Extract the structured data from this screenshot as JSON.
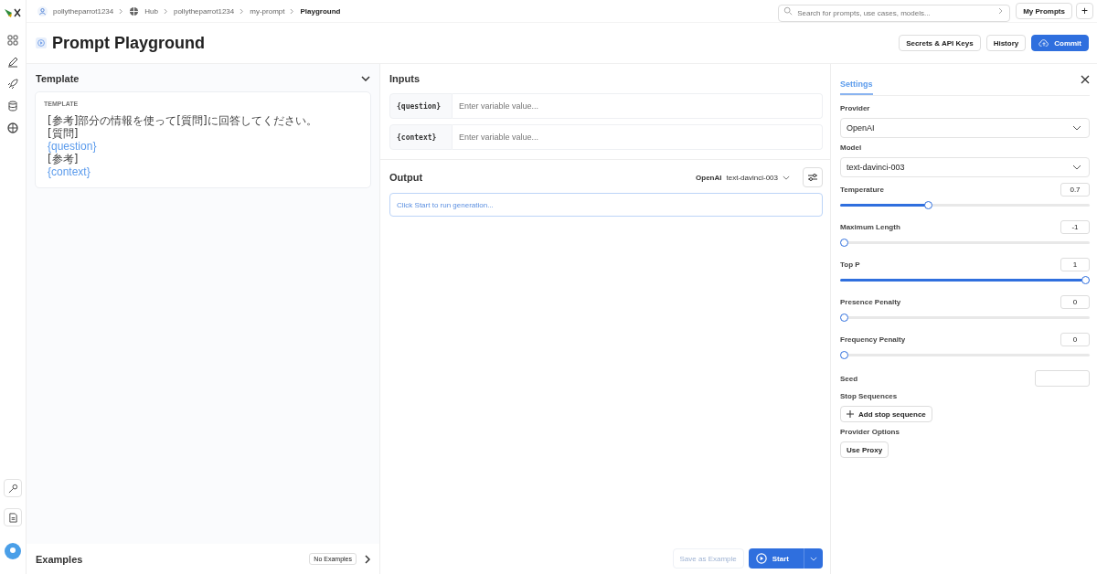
{
  "breadcrumbs": [
    {
      "label": "pollytheparrot1234",
      "kind": "user",
      "current": false
    },
    {
      "label": "Hub",
      "kind": "hub",
      "current": false
    },
    {
      "label": "pollytheparrot1234",
      "kind": "plain",
      "current": false
    },
    {
      "label": "my-prompt",
      "kind": "plain",
      "current": false
    },
    {
      "label": "Playground",
      "kind": "plain",
      "current": true
    }
  ],
  "search": {
    "placeholder": "Search for prompts, use cases, models..."
  },
  "top_buttons": {
    "my_prompts": "My Prompts",
    "add": "+"
  },
  "page_title": "Prompt Playground",
  "header_buttons": {
    "secrets": "Secrets & API Keys",
    "history": "History",
    "commit": "Commit"
  },
  "template": {
    "title": "Template",
    "label": "TEMPLATE",
    "lines": [
      {
        "text": "[参考]部分の情報を使って[質問]に回答してください。",
        "kind": "text"
      },
      {
        "text": "[質問]",
        "kind": "text"
      },
      {
        "text": "{question}",
        "kind": "variable"
      },
      {
        "text": "[参考]",
        "kind": "text"
      },
      {
        "text": "{context}",
        "kind": "variable"
      }
    ]
  },
  "examples": {
    "title": "Examples",
    "badge": "No Examples"
  },
  "inputs": {
    "title": "Inputs",
    "rows": [
      {
        "name": "{question}",
        "placeholder": "Enter variable value..."
      },
      {
        "name": "{context}",
        "placeholder": "Enter variable value..."
      }
    ]
  },
  "output": {
    "title": "Output",
    "provider": "OpenAI",
    "model": "text-davinci-003",
    "placeholder": "Click Start to run generation..."
  },
  "actions": {
    "save": {
      "label": "Save as Example",
      "disabled": true
    },
    "start": "Start"
  },
  "settings": {
    "tab": "Settings",
    "provider_label": "Provider",
    "provider": "OpenAI",
    "model_label": "Model",
    "model": "text-davinci-003",
    "sliders": [
      {
        "label": "Temperature",
        "value": "0.7",
        "level": 0.35
      },
      {
        "label": "Maximum Length",
        "value": "-1",
        "level": 0
      },
      {
        "label": "Top P",
        "value": "1",
        "level": 1
      },
      {
        "label": "Presence Penalty",
        "value": "0",
        "level": 0
      },
      {
        "label": "Frequency Penalty",
        "value": "0",
        "level": 0
      }
    ],
    "seed_label": "Seed",
    "stop_label": "Stop Sequences",
    "add_stop": "Add stop sequence",
    "options_label": "Provider Options",
    "proxy": "Use Proxy"
  }
}
